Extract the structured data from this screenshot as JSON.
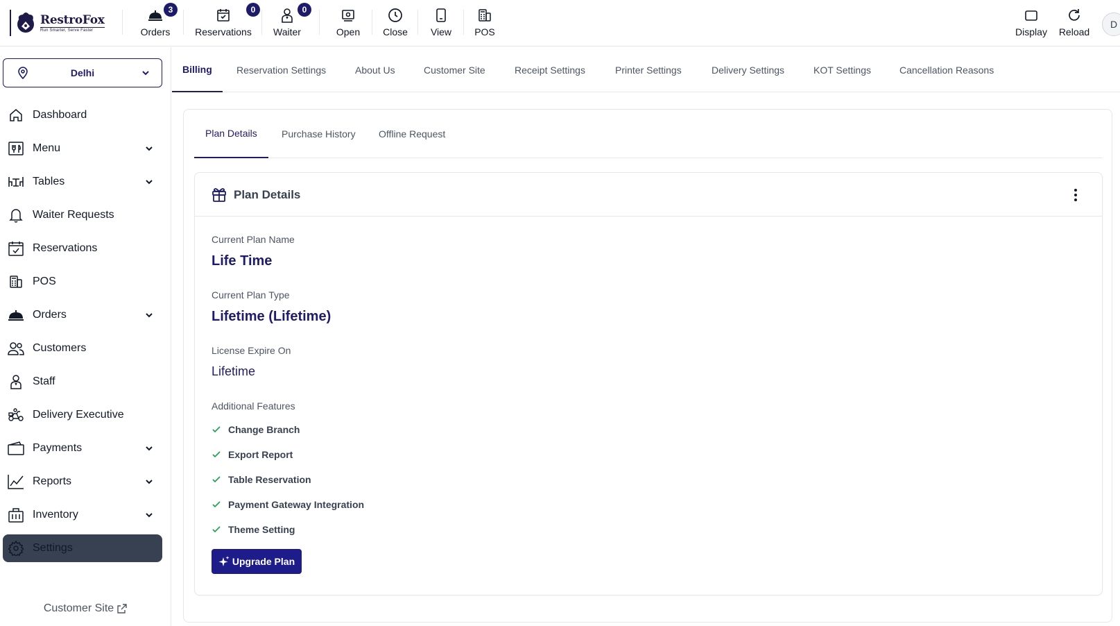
{
  "brand": {
    "name": "RestroFox",
    "tagline": "Run Smarter, Serve Faster"
  },
  "topbar": {
    "buttons": [
      {
        "label": "Orders",
        "icon": "cloche-icon",
        "badge": "3"
      },
      {
        "label": "Reservations",
        "icon": "calendar-check-icon",
        "badge": "0"
      },
      {
        "label": "Waiter",
        "icon": "waiter-icon",
        "badge": "0"
      },
      {
        "label": "Open",
        "icon": "open-register-icon"
      },
      {
        "label": "Close",
        "icon": "clock-icon"
      },
      {
        "label": "View",
        "icon": "tablet-icon"
      },
      {
        "label": "POS",
        "icon": "pos-icon"
      }
    ],
    "right": [
      {
        "label": "Display",
        "icon": "display-icon"
      },
      {
        "label": "Reload",
        "icon": "reload-icon"
      }
    ],
    "avatar_initial": "D"
  },
  "sidebar": {
    "branch": "Delhi",
    "items": [
      {
        "label": "Dashboard",
        "icon": "home-icon",
        "expandable": false
      },
      {
        "label": "Menu",
        "icon": "menu-icon",
        "expandable": true
      },
      {
        "label": "Tables",
        "icon": "table-icon",
        "expandable": true
      },
      {
        "label": "Waiter Requests",
        "icon": "bell-icon",
        "expandable": false
      },
      {
        "label": "Reservations",
        "icon": "calendar-check-icon",
        "expandable": false
      },
      {
        "label": "POS",
        "icon": "pos-icon",
        "expandable": false
      },
      {
        "label": "Orders",
        "icon": "cloche-icon",
        "expandable": true
      },
      {
        "label": "Customers",
        "icon": "users-icon",
        "expandable": false
      },
      {
        "label": "Staff",
        "icon": "staff-icon",
        "expandable": false
      },
      {
        "label": "Delivery Executive",
        "icon": "scooter-icon",
        "expandable": false
      },
      {
        "label": "Payments",
        "icon": "wallet-icon",
        "expandable": true
      },
      {
        "label": "Reports",
        "icon": "chart-icon",
        "expandable": true
      },
      {
        "label": "Inventory",
        "icon": "inventory-icon",
        "expandable": true
      },
      {
        "label": "Settings",
        "icon": "gear-icon",
        "expandable": false,
        "active": true
      }
    ],
    "footer_link": "Customer Site"
  },
  "settings_tabs": [
    "Billing",
    "Reservation Settings",
    "About Us",
    "Customer Site",
    "Receipt Settings",
    "Printer Settings",
    "Delivery Settings",
    "KOT Settings",
    "Cancellation Reasons"
  ],
  "active_settings_tab": "Billing",
  "subtabs": [
    "Plan Details",
    "Purchase History",
    "Offline Request"
  ],
  "active_subtab": "Plan Details",
  "plan": {
    "title": "Plan Details",
    "current_plan_name_label": "Current Plan Name",
    "current_plan_name": "Life Time",
    "current_plan_type_label": "Current Plan Type",
    "current_plan_type": "Lifetime (Lifetime)",
    "license_expire_label": "License Expire On",
    "license_expire": "Lifetime",
    "features_label": "Additional Features",
    "features": [
      "Change Branch",
      "Export Report",
      "Table Reservation",
      "Payment Gateway Integration",
      "Theme Setting"
    ],
    "upgrade_label": "Upgrade Plan"
  },
  "colors": {
    "primary": "#1e1b6b",
    "button": "#1e1b8b",
    "active_nav": "#374151",
    "check": "#16a34a"
  }
}
